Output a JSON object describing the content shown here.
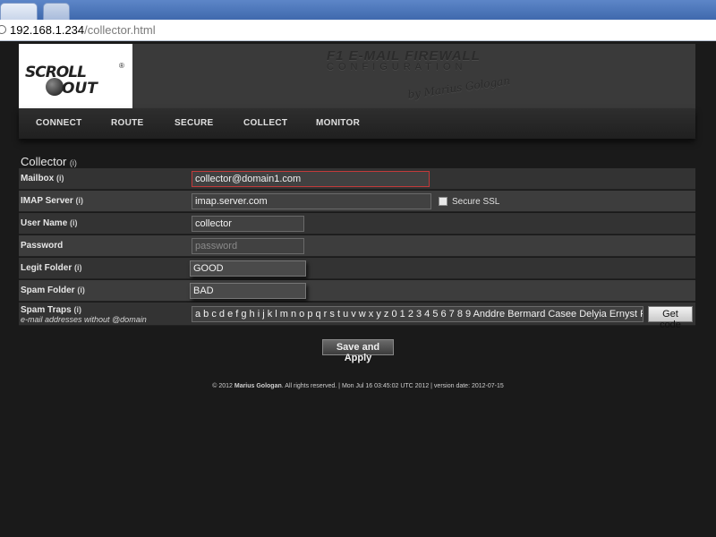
{
  "browser": {
    "address_host": "192.168.1.234",
    "address_path": "/collector.html"
  },
  "header": {
    "logo_top": "SCROLL",
    "logo_bottom": "OUT",
    "logo_reg": "®",
    "title": "F1 E-MAIL FIREWALL",
    "subtitle": "CONFIGURATION",
    "signature": "by Marius Gologan"
  },
  "nav": {
    "items": [
      "CONNECT",
      "ROUTE",
      "SECURE",
      "COLLECT",
      "MONITOR"
    ]
  },
  "section": {
    "title": "Collector",
    "info": "(i)"
  },
  "form": {
    "mailbox": {
      "label": "Mailbox",
      "info": "(i)",
      "value": "collector@domain1.com"
    },
    "imap_server": {
      "label": "IMAP Server",
      "info": "(i)",
      "value": "imap.server.com",
      "ssl_label": "Secure SSL"
    },
    "user_name": {
      "label": "User Name",
      "info": "(i)",
      "value": "collector"
    },
    "password": {
      "label": "Password",
      "placeholder": "password"
    },
    "legit_folder": {
      "label": "Legit Folder",
      "info": "(i)",
      "value": "GOOD"
    },
    "spam_folder": {
      "label": "Spam Folder",
      "info": "(i)",
      "value": "BAD"
    },
    "spam_traps": {
      "label": "Spam Traps",
      "info": "(i)",
      "sublabel": "e-mail addresses without @domain",
      "value": "a b c d e f g h i j k l m n o p q r s t u v w x y z 0 1 2 3 4 5 6 7 8 9 Anddre Bermard Casee Delyia Ernyst Franc",
      "button": "Get code"
    },
    "submit": "Save and Apply"
  },
  "footer": {
    "copyright": "© 2012 ",
    "author": "Marius Gologan",
    "rest": ". All rights reserved. | Mon Jul 16 03:45:02 UTC 2012 | version date: 2012-07-15"
  }
}
